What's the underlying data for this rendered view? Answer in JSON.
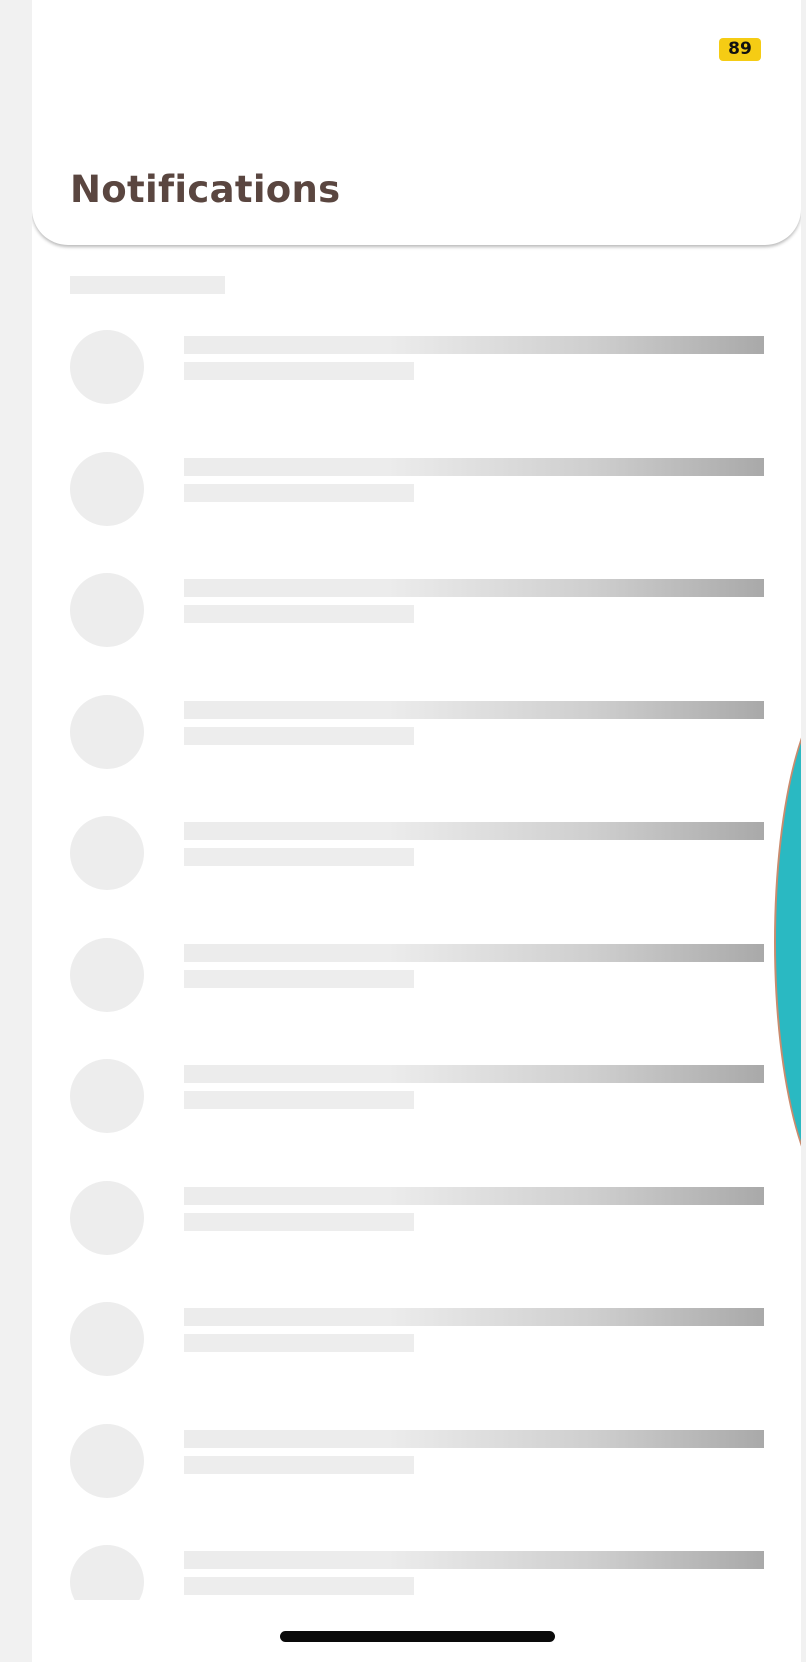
{
  "status": {
    "badge_text": "89"
  },
  "header": {
    "title": "Notifications"
  },
  "skeleton": {
    "row_count": 11,
    "avatar_color": "#ededed",
    "line_color": "#ececec",
    "line_gradient_end": "#a9a9a9"
  },
  "colors": {
    "badge": "#f5cc14",
    "title": "#5a4640",
    "teal_accent": "#2ab9c2",
    "background": "#f1f1f1",
    "home_indicator": "#0a0a0a"
  }
}
